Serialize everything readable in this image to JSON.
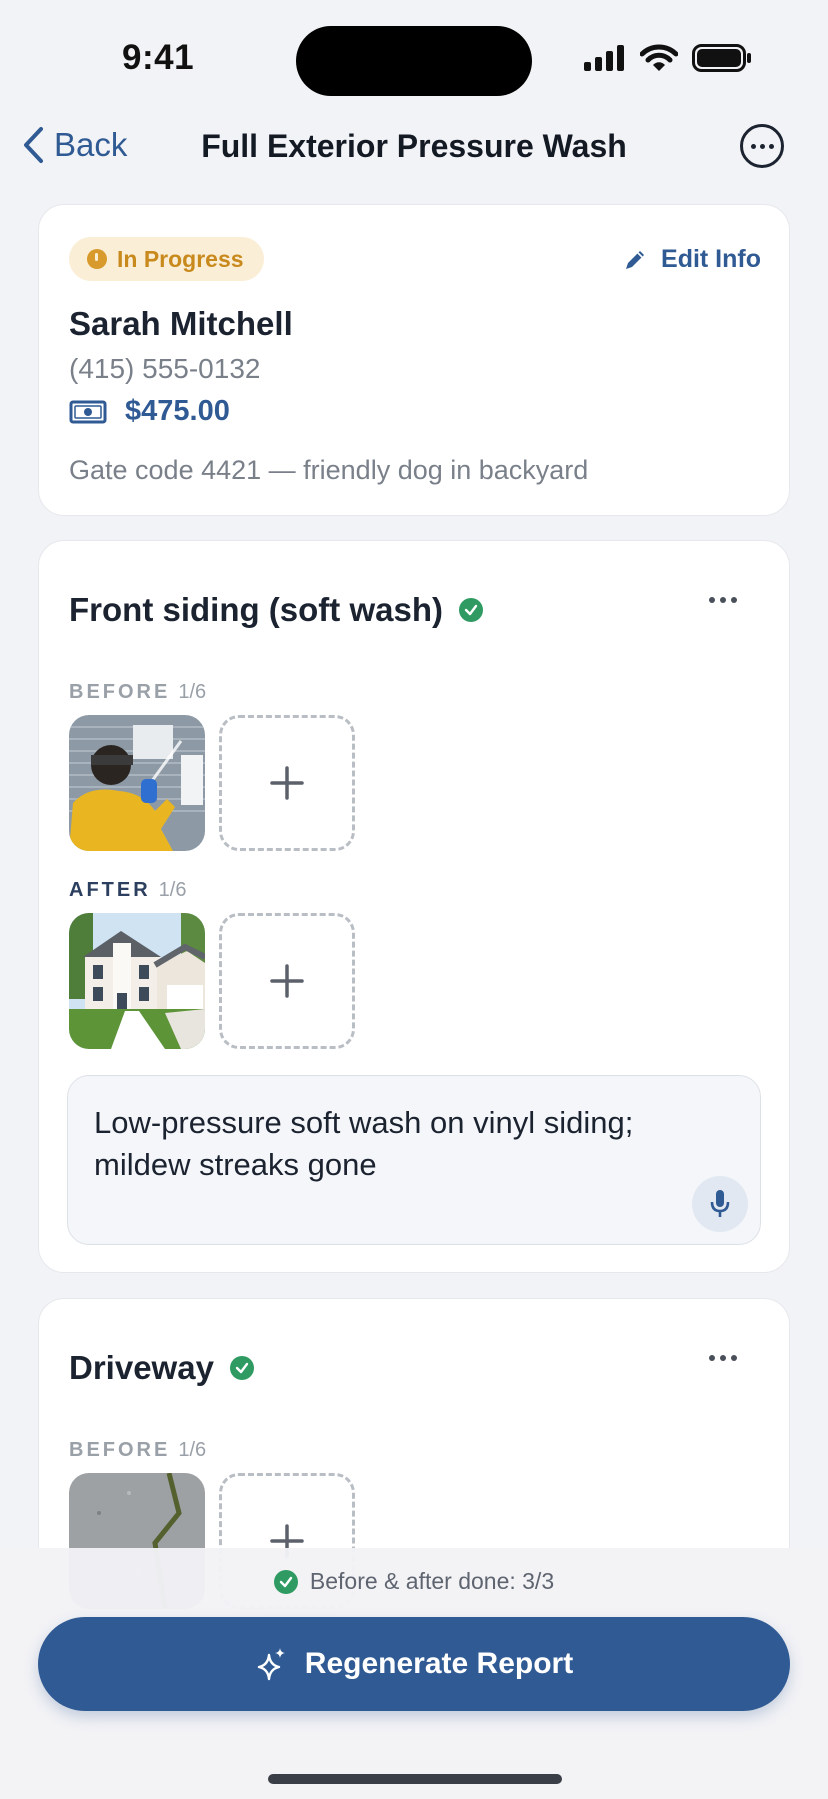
{
  "status_bar": {
    "time": "9:41"
  },
  "nav": {
    "back_label": "Back",
    "title": "Full Exterior Pressure Wash"
  },
  "job": {
    "status": "In Progress",
    "edit_label": "Edit Info",
    "customer_name": "Sarah Mitchell",
    "phone": "(415) 555-0132",
    "price": "$475.00",
    "note": "Gate code 4421 — friendly dog in backyard"
  },
  "sections": [
    {
      "title": "Front siding (soft wash)",
      "before_label": "BEFORE",
      "before_count": "1/6",
      "after_label": "AFTER",
      "after_count": "1/6",
      "note": "Low-pressure soft wash on vinyl siding; mildew streaks gone"
    },
    {
      "title": "Driveway",
      "before_label": "BEFORE",
      "before_count": "1/6"
    }
  ],
  "footer": {
    "progress_text": "Before & after done: 3/3",
    "button_label": "Regenerate Report"
  },
  "colors": {
    "accent": "#2f5a93",
    "status": "#d89a2c",
    "success": "#2f9b62"
  }
}
